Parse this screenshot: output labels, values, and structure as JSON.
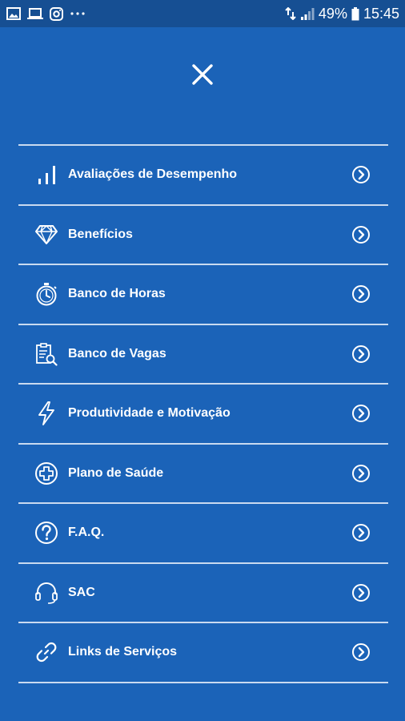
{
  "status_bar": {
    "battery": "49%",
    "time": "15:45",
    "notification_icons": [
      "image-icon",
      "laptop-icon",
      "instagram-icon",
      "more-dots-icon"
    ],
    "system_icons": [
      "data-transfer-icon",
      "signal-icon",
      "battery-icon"
    ]
  },
  "menu": {
    "close_icon": "close-icon",
    "items": [
      {
        "label": "Avaliações de Desempenho",
        "icon": "bar-chart-icon"
      },
      {
        "label": "Benefícios",
        "icon": "diamond-icon"
      },
      {
        "label": "Banco de Horas",
        "icon": "stopwatch-icon"
      },
      {
        "label": "Banco de Vagas",
        "icon": "clipboard-search-icon"
      },
      {
        "label": "Produtividade e Motivação",
        "icon": "lightning-icon"
      },
      {
        "label": "Plano de Saúde",
        "icon": "health-plus-icon"
      },
      {
        "label": "F.A.Q.",
        "icon": "question-icon"
      },
      {
        "label": "SAC",
        "icon": "headset-icon"
      },
      {
        "label": "Links de Serviços",
        "icon": "link-icon"
      }
    ],
    "item_arrow_icon": "chevron-right-circle-icon"
  },
  "colors": {
    "background": "#1b63b8",
    "status_bar": "#164f93",
    "divider": "#c9daf0",
    "text": "#ffffff"
  }
}
